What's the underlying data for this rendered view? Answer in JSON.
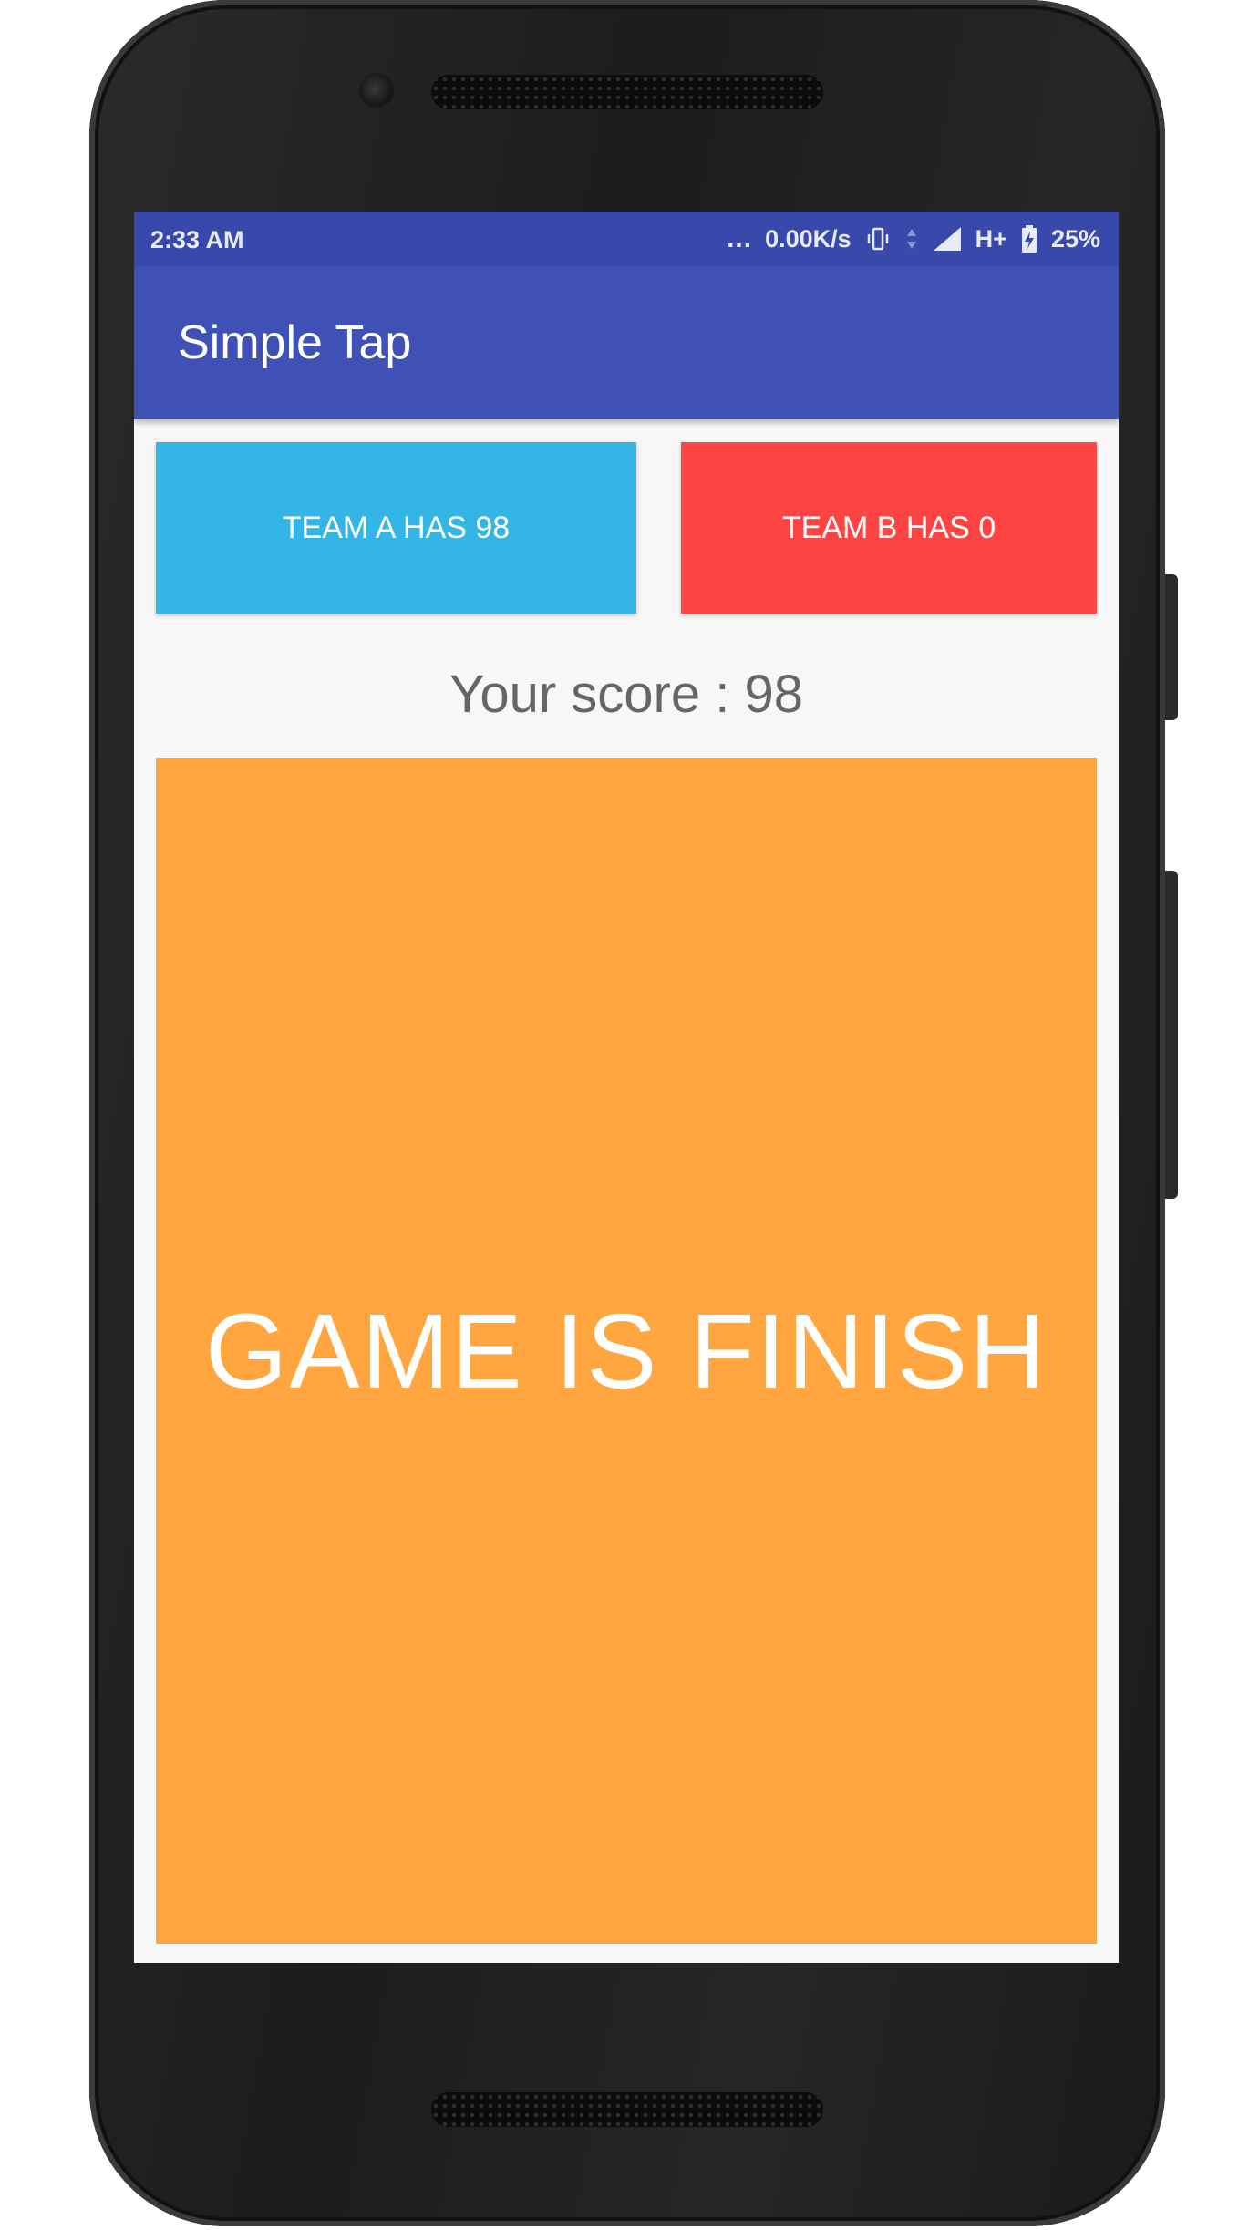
{
  "status_bar": {
    "time": "2:33 AM",
    "dots": "...",
    "network_speed": "0.00K/s",
    "network_type": "H+",
    "battery": "25%",
    "icons": [
      "vibrate-icon",
      "data-arrows-icon",
      "signal-icon",
      "battery-charging-icon"
    ]
  },
  "app_bar": {
    "title": "Simple Tap"
  },
  "buttons": {
    "team_a": "TEAM A HAS 98",
    "team_b": "TEAM B HAS 0"
  },
  "score_text": "Your score : 98",
  "game_area": {
    "message": "GAME IS FINISH"
  },
  "colors": {
    "status_bar": "#3949ab",
    "app_bar": "#3f51b5",
    "team_a": "#33b5e5",
    "team_b": "#ff4444",
    "game_area": "#ffa640",
    "score_text": "#666666"
  }
}
